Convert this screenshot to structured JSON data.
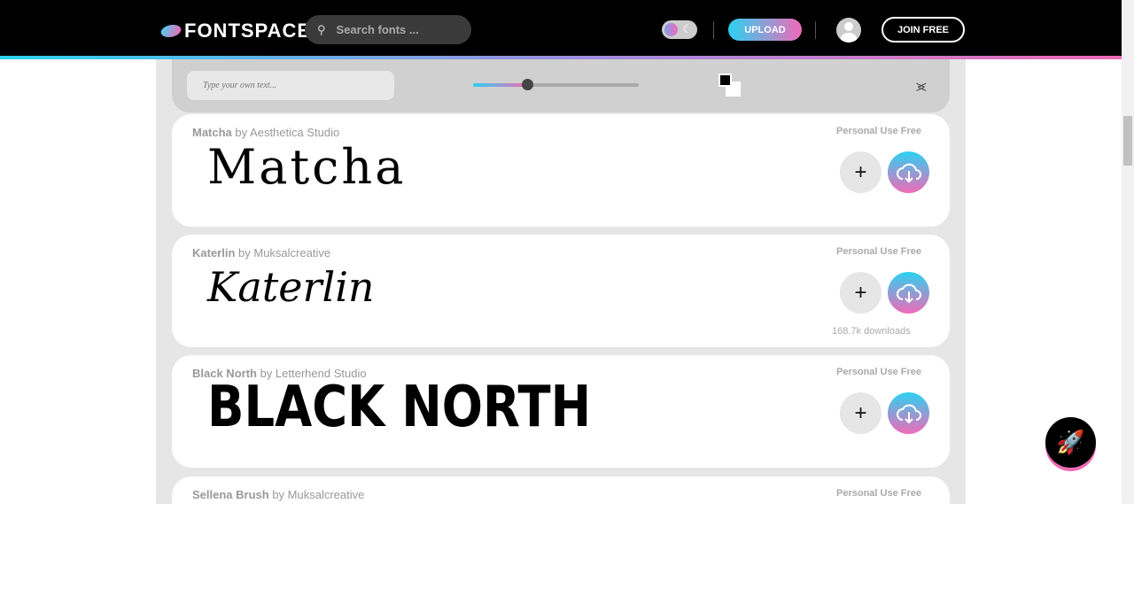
{
  "header": {
    "logo": "FONTSPACE",
    "search_placeholder": "Search fonts ...",
    "upload": "UPLOAD",
    "join": "JOIN FREE"
  },
  "toolbar": {
    "text_placeholder": "Type your own text...",
    "size_level": 0.32
  },
  "fonts": [
    {
      "name": "Matcha",
      "by": "by Aesthetica Studio",
      "license": "Personal Use Free",
      "preview": "Matcha",
      "downloads": ""
    },
    {
      "name": "Katerlin",
      "by": "by Muksalcreative",
      "license": "Personal Use Free",
      "preview": "Katerlin",
      "downloads": "168.7k downloads"
    },
    {
      "name": "Black North",
      "by": "by Letterhend Studio",
      "license": "Personal Use Free",
      "preview": "BLACK NORTH",
      "downloads": ""
    },
    {
      "name": "Sellena Brush",
      "by": "by Muksalcreative",
      "license": "Personal Use Free",
      "preview": "",
      "downloads": ""
    }
  ],
  "colors": {
    "accent_start": "#2bd2f2",
    "accent_end": "#f06ab8"
  }
}
